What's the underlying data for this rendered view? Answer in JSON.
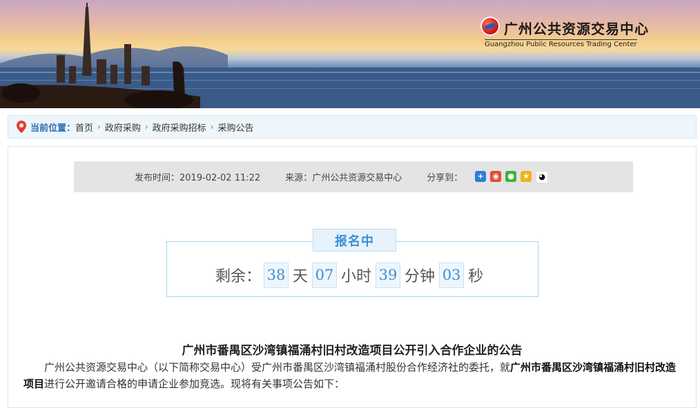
{
  "header": {
    "logo_cn": "广州公共资源交易中心",
    "logo_en": "Guangzhou Public Resources Trading Center",
    "logo_icon": "gpr-logo-icon"
  },
  "breadcrumb": {
    "label": "当前位置：",
    "items": [
      "首页",
      "政府采购",
      "政府采购招标",
      "采购公告"
    ],
    "separator": "›"
  },
  "meta": {
    "publish_label": "发布时间：",
    "publish_time": "2019-02-02 11:22",
    "source_label": "来源：",
    "source": "广州公共资源交易中心",
    "share_label": "分享到：",
    "share_icons": [
      "plus-icon",
      "weibo-icon",
      "wechat-icon",
      "qzone-icon",
      "qq-icon"
    ]
  },
  "countdown": {
    "status": "报名中",
    "remaining_label": "剩余：",
    "days": "38",
    "days_unit": "天",
    "hours": "07",
    "hours_unit": "小时",
    "minutes": "39",
    "minutes_unit": "分钟",
    "seconds": "03",
    "seconds_unit": "秒"
  },
  "article": {
    "title": "广州市番禺区沙湾镇福涌村旧村改造项目公开引入合作企业的公告",
    "para_prefix": "广州公共资源交易中心（以下简称交易中心）受广州市番禺区沙湾镇福涌村股份合作经济社的委托，就",
    "para_bold": "广州市番禺区沙湾镇福涌村旧村改造项目",
    "para_suffix": "进行公开邀请合格的申请企业参加竞选。现将有关事项公告如下："
  },
  "colors": {
    "accent": "#3a8fd6",
    "crumb_label": "#2a6fb0",
    "panel_border": "#d6e7f1"
  }
}
